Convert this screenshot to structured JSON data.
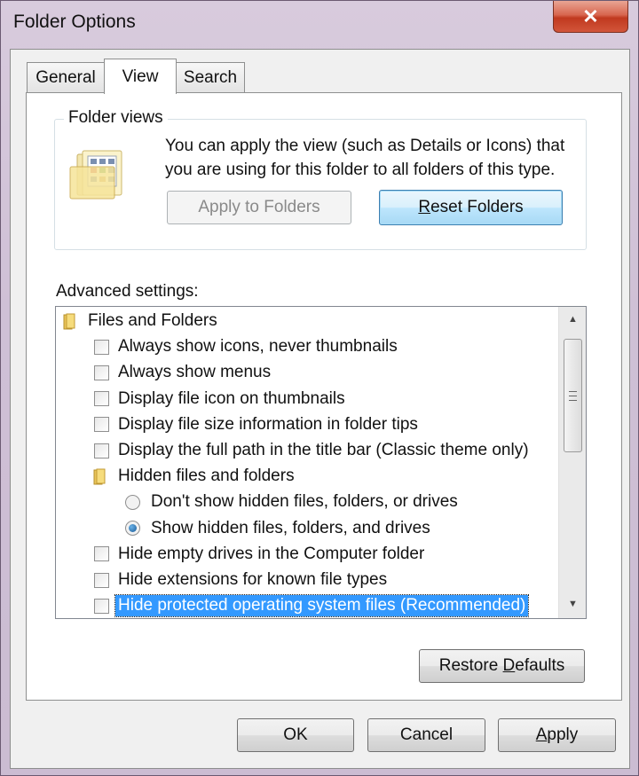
{
  "window": {
    "title": "Folder Options",
    "close_icon": "close-icon"
  },
  "tabs": [
    {
      "label": "General",
      "active": false
    },
    {
      "label": "View",
      "active": true
    },
    {
      "label": "Search",
      "active": false
    }
  ],
  "folder_views": {
    "legend": "Folder views",
    "description": "You can apply the view (such as Details or Icons) that you are using for this folder to all folders of this type.",
    "apply_button": "Apply to Folders",
    "reset_button_pre": "",
    "reset_button_underline": "R",
    "reset_button_post": "eset Folders"
  },
  "advanced": {
    "label": "Advanced settings:",
    "items": [
      {
        "type": "folder",
        "label": "Files and Folders"
      },
      {
        "type": "checkbox",
        "label": "Always show icons, never thumbnails",
        "checked": false
      },
      {
        "type": "checkbox",
        "label": "Always show menus",
        "checked": false
      },
      {
        "type": "checkbox",
        "label": "Display file icon on thumbnails",
        "checked": false
      },
      {
        "type": "checkbox",
        "label": "Display file size information in folder tips",
        "checked": false
      },
      {
        "type": "checkbox",
        "label": "Display the full path in the title bar (Classic theme only)",
        "checked": false
      },
      {
        "type": "folder",
        "label": "Hidden files and folders"
      },
      {
        "type": "radio",
        "label": "Don't show hidden files, folders, or drives",
        "checked": false
      },
      {
        "type": "radio",
        "label": "Show hidden files, folders, and drives",
        "checked": true
      },
      {
        "type": "checkbox",
        "label": "Hide empty drives in the Computer folder",
        "checked": false
      },
      {
        "type": "checkbox",
        "label": "Hide extensions for known file types",
        "checked": false
      },
      {
        "type": "checkbox",
        "label": "Hide protected operating system files (Recommended)",
        "checked": false,
        "selected": true
      }
    ]
  },
  "restore_defaults": {
    "pre": "Restore ",
    "underline": "D",
    "post": "efaults"
  },
  "footer": {
    "ok": "OK",
    "cancel": "Cancel",
    "apply_underline": "A",
    "apply_post": "pply"
  }
}
